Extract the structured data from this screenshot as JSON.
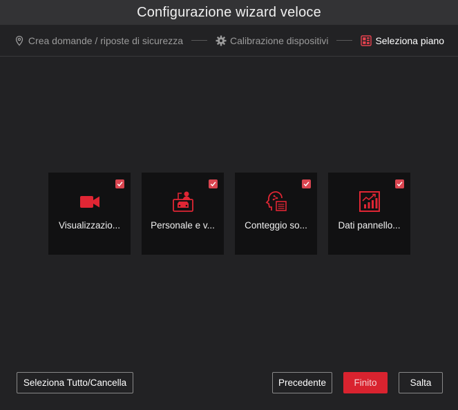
{
  "window": {
    "title": "Configurazione wizard veloce"
  },
  "steps": [
    {
      "label": "Crea domande / riposte di sicurezza",
      "icon": "location-pin-icon",
      "active": false
    },
    {
      "label": "Calibrazione dispositivi",
      "icon": "gear-icon",
      "active": false
    },
    {
      "label": "Seleziona piano",
      "icon": "layout-grid-icon",
      "active": true
    }
  ],
  "tiles": [
    {
      "label": "Visualizzazio...",
      "icon": "video-camera-icon",
      "checked": true
    },
    {
      "label": "Personale e v...",
      "icon": "person-vehicle-icon",
      "checked": true
    },
    {
      "label": "Conteggio so...",
      "icon": "head-counting-icon",
      "checked": true
    },
    {
      "label": "Dati pannello...",
      "icon": "chart-panel-icon",
      "checked": true
    }
  ],
  "buttons": {
    "select_all": "Seleziona Tutto/Cancella",
    "previous": "Precedente",
    "finish": "Finito",
    "skip": "Salta"
  },
  "colors": {
    "accent": "#d9232f",
    "background": "#222224",
    "tile": "#111112",
    "titlebar": "#333335"
  }
}
